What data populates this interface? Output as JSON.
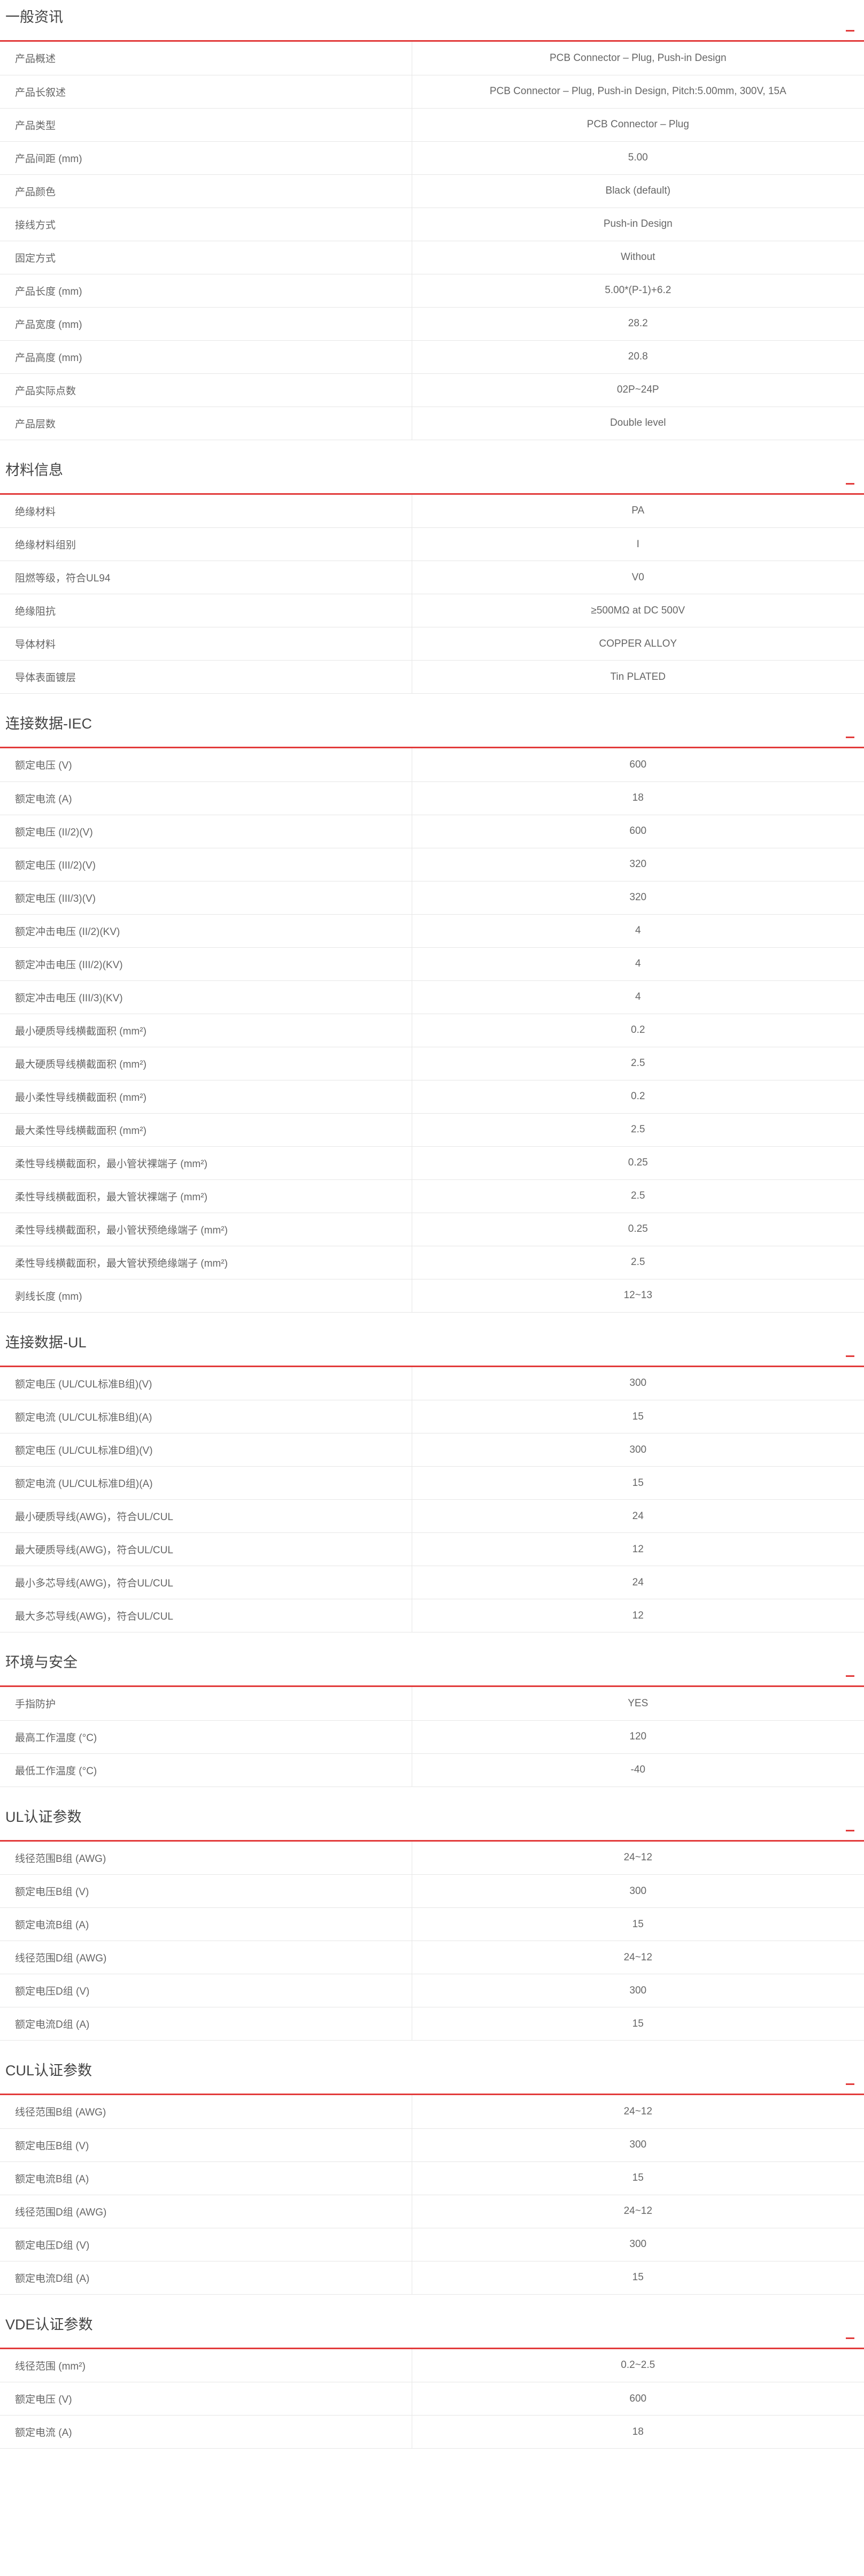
{
  "sections": [
    {
      "title": "一般资讯",
      "rows": [
        {
          "label": "产品概述",
          "value": "PCB Connector – Plug, Push-in Design"
        },
        {
          "label": "产品长叙述",
          "value": "PCB Connector – Plug, Push-in Design, Pitch:5.00mm, 300V, 15A"
        },
        {
          "label": "产品类型",
          "value": "PCB Connector – Plug"
        },
        {
          "label": "产品间距 (mm)",
          "value": "5.00"
        },
        {
          "label": "产品颜色",
          "value": "Black (default)"
        },
        {
          "label": "接线方式",
          "value": "Push-in Design"
        },
        {
          "label": "固定方式",
          "value": "Without"
        },
        {
          "label": "产品长度 (mm)",
          "value": "5.00*(P-1)+6.2"
        },
        {
          "label": "产品宽度 (mm)",
          "value": "28.2"
        },
        {
          "label": "产品高度 (mm)",
          "value": "20.8"
        },
        {
          "label": "产品实际点数",
          "value": "02P~24P"
        },
        {
          "label": "产品层数",
          "value": "Double level"
        }
      ]
    },
    {
      "title": "材料信息",
      "rows": [
        {
          "label": "绝缘材料",
          "value": "PA"
        },
        {
          "label": "绝缘材料组别",
          "value": "I"
        },
        {
          "label": "阻燃等级，符合UL94",
          "value": "V0"
        },
        {
          "label": "绝缘阻抗",
          "value": "≥500MΩ at DC 500V"
        },
        {
          "label": "导体材料",
          "value": "COPPER ALLOY"
        },
        {
          "label": "导体表面镀层",
          "value": "Tin PLATED"
        }
      ]
    },
    {
      "title": "连接数据-IEC",
      "rows": [
        {
          "label": "额定电压 (V)",
          "value": "600"
        },
        {
          "label": "额定电流 (A)",
          "value": "18"
        },
        {
          "label": "额定电压 (II/2)(V)",
          "value": "600"
        },
        {
          "label": "额定电压 (III/2)(V)",
          "value": "320"
        },
        {
          "label": "额定电压 (III/3)(V)",
          "value": "320"
        },
        {
          "label": "额定冲击电压 (II/2)(KV)",
          "value": "4"
        },
        {
          "label": "额定冲击电压 (III/2)(KV)",
          "value": "4"
        },
        {
          "label": "额定冲击电压 (III/3)(KV)",
          "value": "4"
        },
        {
          "label": "最小硬质导线横截面积 (mm²)",
          "value": "0.2"
        },
        {
          "label": "最大硬质导线横截面积 (mm²)",
          "value": "2.5"
        },
        {
          "label": "最小柔性导线横截面积 (mm²)",
          "value": "0.2"
        },
        {
          "label": "最大柔性导线横截面积 (mm²)",
          "value": "2.5"
        },
        {
          "label": "柔性导线横截面积，最小管状裸端子 (mm²)",
          "value": "0.25"
        },
        {
          "label": "柔性导线横截面积，最大管状裸端子 (mm²)",
          "value": "2.5"
        },
        {
          "label": "柔性导线横截面积，最小管状预绝缘端子 (mm²)",
          "value": "0.25"
        },
        {
          "label": "柔性导线横截面积，最大管状预绝缘端子 (mm²)",
          "value": "2.5"
        },
        {
          "label": "剥线长度 (mm)",
          "value": "12~13"
        }
      ]
    },
    {
      "title": "连接数据-UL",
      "rows": [
        {
          "label": "额定电压 (UL/CUL标准B组)(V)",
          "value": "300"
        },
        {
          "label": "额定电流 (UL/CUL标准B组)(A)",
          "value": "15"
        },
        {
          "label": "额定电压 (UL/CUL标准D组)(V)",
          "value": "300"
        },
        {
          "label": "额定电流 (UL/CUL标准D组)(A)",
          "value": "15"
        },
        {
          "label": "最小硬质导线(AWG)，符合UL/CUL",
          "value": "24"
        },
        {
          "label": "最大硬质导线(AWG)，符合UL/CUL",
          "value": "12"
        },
        {
          "label": "最小多芯导线(AWG)，符合UL/CUL",
          "value": "24"
        },
        {
          "label": "最大多芯导线(AWG)，符合UL/CUL",
          "value": "12"
        }
      ]
    },
    {
      "title": "环境与安全",
      "rows": [
        {
          "label": "手指防护",
          "value": "YES"
        },
        {
          "label": "最高工作温度 (°C)",
          "value": "120"
        },
        {
          "label": "最低工作温度 (°C)",
          "value": "-40"
        }
      ]
    },
    {
      "title": "UL认证参数",
      "rows": [
        {
          "label": "线径范围B组 (AWG)",
          "value": "24~12"
        },
        {
          "label": "额定电压B组 (V)",
          "value": "300"
        },
        {
          "label": "额定电流B组 (A)",
          "value": "15"
        },
        {
          "label": "线径范围D组 (AWG)",
          "value": "24~12"
        },
        {
          "label": "额定电压D组 (V)",
          "value": "300"
        },
        {
          "label": "额定电流D组 (A)",
          "value": "15"
        }
      ]
    },
    {
      "title": "CUL认证参数",
      "rows": [
        {
          "label": "线径范围B组 (AWG)",
          "value": "24~12"
        },
        {
          "label": "额定电压B组 (V)",
          "value": "300"
        },
        {
          "label": "额定电流B组 (A)",
          "value": "15"
        },
        {
          "label": "线径范围D组 (AWG)",
          "value": "24~12"
        },
        {
          "label": "额定电压D组 (V)",
          "value": "300"
        },
        {
          "label": "额定电流D组 (A)",
          "value": "15"
        }
      ]
    },
    {
      "title": "VDE认证参数",
      "rows": [
        {
          "label": "线径范围 (mm²)",
          "value": "0.2~2.5"
        },
        {
          "label": "额定电压 (V)",
          "value": "600"
        },
        {
          "label": "额定电流 (A)",
          "value": "18"
        }
      ]
    }
  ],
  "colors": {
    "accent": "#e23a3a",
    "row_border": "#e6e6e6",
    "text": "#666666"
  },
  "icons": {
    "section_toggle": "collapse-minus-icon"
  }
}
